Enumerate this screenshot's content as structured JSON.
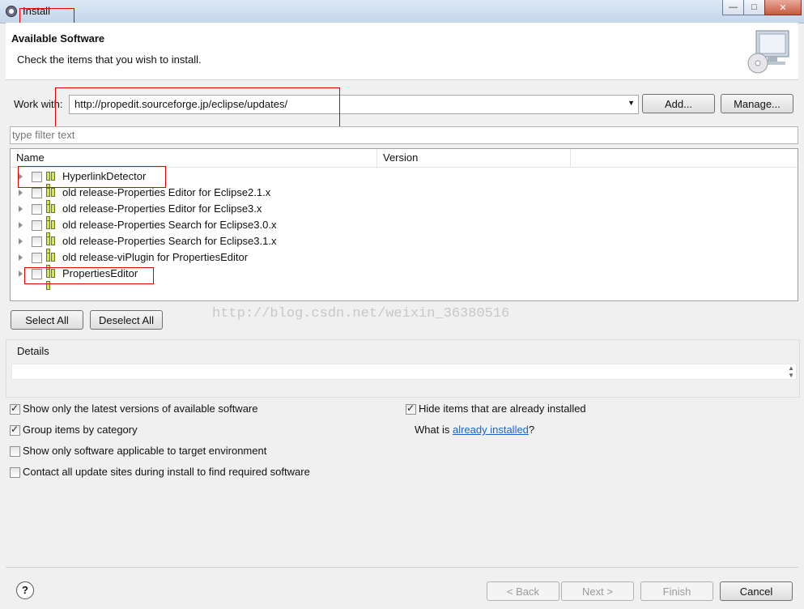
{
  "window": {
    "title": "Install"
  },
  "header": {
    "title": "Available Software",
    "subtitle": "Check the items that you wish to install."
  },
  "work_with": {
    "label": "Work with:",
    "value": "http://propedit.sourceforge.jp/eclipse/updates/",
    "add": "Add...",
    "manage": "Manage..."
  },
  "filter": {
    "placeholder": "type filter text"
  },
  "table": {
    "columns": [
      "Name",
      "Version"
    ],
    "rows": [
      "HyperlinkDetector",
      "old release-Properties Editor for Eclipse2.1.x",
      "old release-Properties Editor for Eclipse3.x",
      "old release-Properties Search for Eclipse3.0.x",
      "old release-Properties Search for Eclipse3.1.x",
      "old release-viPlugin for PropertiesEditor",
      "PropertiesEditor"
    ]
  },
  "selection": {
    "select_all": "Select All",
    "deselect_all": "Deselect All"
  },
  "watermark": "http://blog.csdn.net/weixin_36380516",
  "details": {
    "label": "Details"
  },
  "options": {
    "latest_only": {
      "label": "Show only the latest versions of available software",
      "checked": true
    },
    "group_by_category": {
      "label": "Group items by category",
      "checked": true
    },
    "target_env": {
      "label": "Show only software applicable to target environment",
      "checked": false
    },
    "contact_all": {
      "label": "Contact all update sites during install to find required software",
      "checked": false
    },
    "hide_installed": {
      "label": "Hide items that are already installed",
      "checked": true
    },
    "what_is": "What is",
    "already_installed_link": "already installed",
    "question_mark": "?"
  },
  "footer": {
    "help": "?",
    "back": "< Back",
    "next": "Next >",
    "finish": "Finish",
    "cancel": "Cancel"
  },
  "colors": {
    "annotation_red": "#e00000",
    "link": "#1a66cc"
  }
}
